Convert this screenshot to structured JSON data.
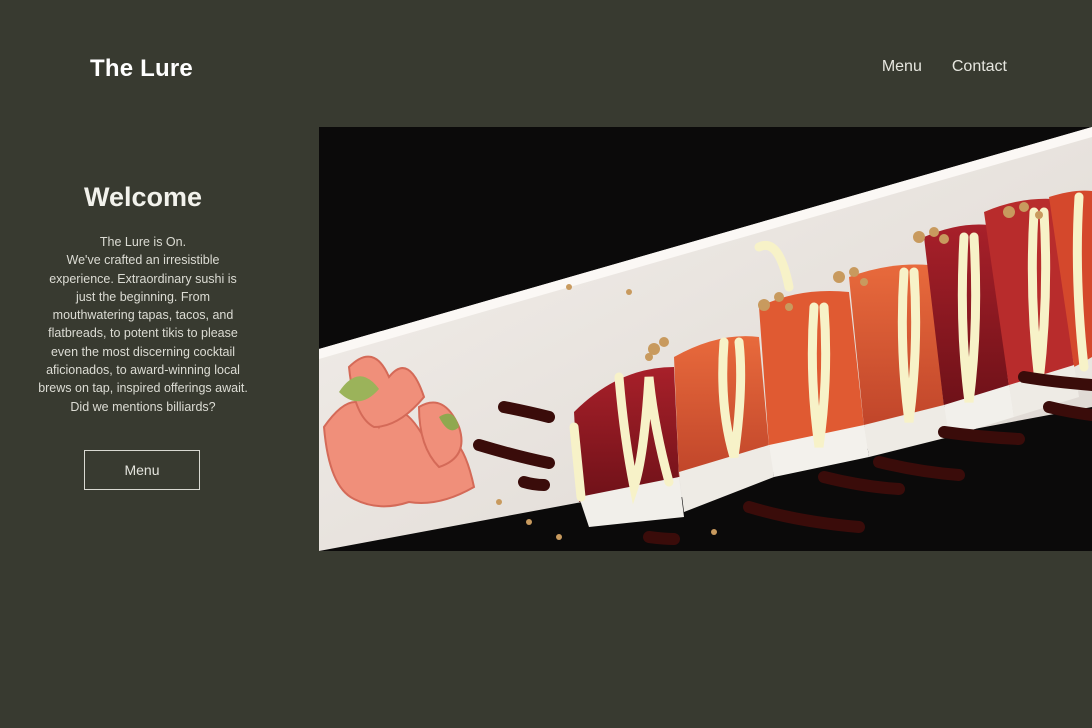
{
  "header": {
    "brand": "The Lure",
    "nav": {
      "menu": "Menu",
      "contact": "Contact"
    }
  },
  "welcome": {
    "heading": "Welcome",
    "intro": "The Lure is On.\nWe've crafted an irresistible experience. Extraordinary sushi is just the beginning. From mouthwatering tapas, tacos, and flatbreads, to potent tikis to please even the most discerning cocktail aficionados, to award-winning local brews on tap, inspired offerings await. Did we mentions billiards?",
    "button_label": "Menu"
  },
  "colors": {
    "background": "#383a30",
    "text": "#ffffff"
  }
}
